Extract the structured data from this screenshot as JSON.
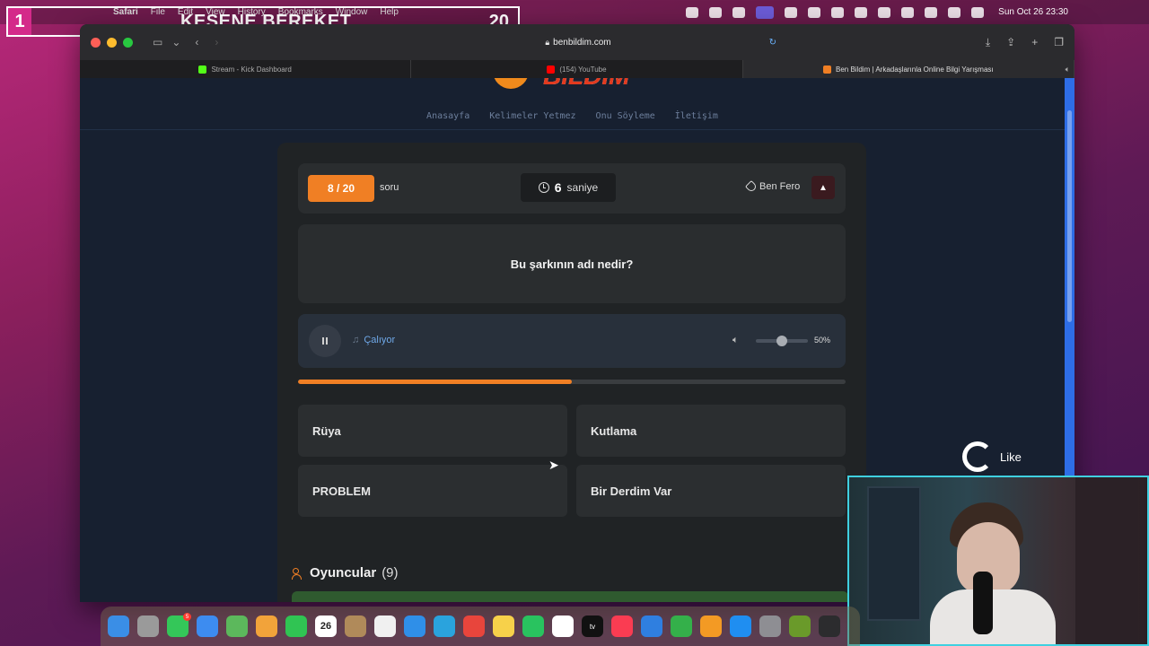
{
  "menubar": {
    "app": "Safari",
    "items": [
      "File",
      "Edit",
      "View",
      "History",
      "Bookmarks",
      "Window",
      "Help"
    ],
    "datetime": "Sun Oct 26  23:30"
  },
  "overlay": {
    "number": "1",
    "title": "KESENE BEREKET",
    "count": "20"
  },
  "browser": {
    "url": "benbildim.com",
    "tabs": [
      {
        "label": "Stream - Kick Dashboard",
        "color": "#53fc18"
      },
      {
        "label": "(154) YouTube",
        "color": "#ff0000"
      },
      {
        "label": "Ben Bildim | Arkadaşlarınla Online Bilgi Yarışması",
        "color": "#f07f24"
      }
    ]
  },
  "site": {
    "logo_text": "BILDIM",
    "nav": [
      "Anasayfa",
      "Kelimeler Yetmez",
      "Onu Söyleme",
      "İletişim"
    ]
  },
  "quiz": {
    "progress": "8 / 20",
    "progress_suffix": "soru",
    "timer_value": "6",
    "timer_unit": "saniye",
    "player_name": "Ben Fero",
    "warn_icon": "▲",
    "question": "Bu şarkının adı nedir?",
    "audio_status": "Çalıyor",
    "volume_pct": "50%",
    "volume_level": 0.5,
    "time_progress": 0.5,
    "answers": [
      "Rüya",
      "Kutlama",
      "PROBLEM",
      "Bir Derdim Var"
    ],
    "players_label": "Oyuncular",
    "players_count": "(9)"
  },
  "like_widget": {
    "label": "Like"
  },
  "dock": {
    "apps": [
      {
        "name": "finder",
        "color": "#3a8ee6"
      },
      {
        "name": "launchpad",
        "color": "#9a9a9a"
      },
      {
        "name": "messages",
        "color": "#34c759",
        "badge": "5"
      },
      {
        "name": "mail",
        "color": "#3d8cf0"
      },
      {
        "name": "maps",
        "color": "#5cb85c"
      },
      {
        "name": "photos",
        "color": "#f2a33a"
      },
      {
        "name": "facetime",
        "color": "#30c453"
      },
      {
        "name": "calendar",
        "color": "#ffffff",
        "label": "26"
      },
      {
        "name": "contacts",
        "color": "#b08a5a"
      },
      {
        "name": "reminders",
        "color": "#f0f0f0"
      },
      {
        "name": "safari",
        "color": "#2f8fe8"
      },
      {
        "name": "telegram",
        "color": "#2aa3dd"
      },
      {
        "name": "chrome",
        "color": "#e8453c"
      },
      {
        "name": "notes",
        "color": "#f7d14a"
      },
      {
        "name": "whatsapp",
        "color": "#29c35f"
      },
      {
        "name": "freeform",
        "color": "#ffffff"
      },
      {
        "name": "appletv",
        "color": "#111111",
        "label": "tv"
      },
      {
        "name": "music",
        "color": "#fa3c52"
      },
      {
        "name": "keynote",
        "color": "#2f7fe0"
      },
      {
        "name": "numbers",
        "color": "#34b04a"
      },
      {
        "name": "pages",
        "color": "#f39a24"
      },
      {
        "name": "appstore",
        "color": "#1f8ef1"
      },
      {
        "name": "settings",
        "color": "#8e8e93"
      },
      {
        "name": "game",
        "color": "#6a9a2a"
      },
      {
        "name": "grid",
        "color": "#2c2c2e"
      }
    ]
  }
}
